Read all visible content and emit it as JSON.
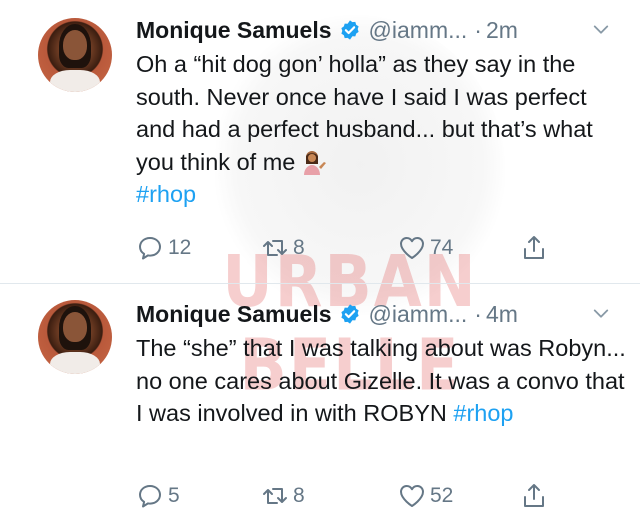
{
  "tweets": [
    {
      "author_name": "Monique Samuels",
      "handle": "@iamm...",
      "separator": "·",
      "time": "2m",
      "text_before": "Oh a “hit dog gon’ holla” as they say in the south. Never once have I said I was perfect and had a perfect husband... but that’s what you think of me",
      "hashtag": "#rhop",
      "emoji_icon": "woman-tipping-hand-icon",
      "replies": "12",
      "retweets": "8",
      "likes": "74"
    },
    {
      "author_name": "Monique Samuels",
      "handle": "@iamm...",
      "separator": "·",
      "time": "4m",
      "text_before": "The “she” that I was talking about was Robyn... no one cares about Gizelle. It was a convo that I was involved in with ROBYN ",
      "hashtag": "#rhop",
      "replies": "5",
      "retweets": "8",
      "likes": "52"
    }
  ],
  "watermark": "URBAN BELLE",
  "colors": {
    "link": "#1da1f2",
    "verified": "#1da1f2",
    "muted": "#657786",
    "text": "#14171a",
    "divider": "#e1e8ed",
    "watermark": "#dd5050"
  }
}
